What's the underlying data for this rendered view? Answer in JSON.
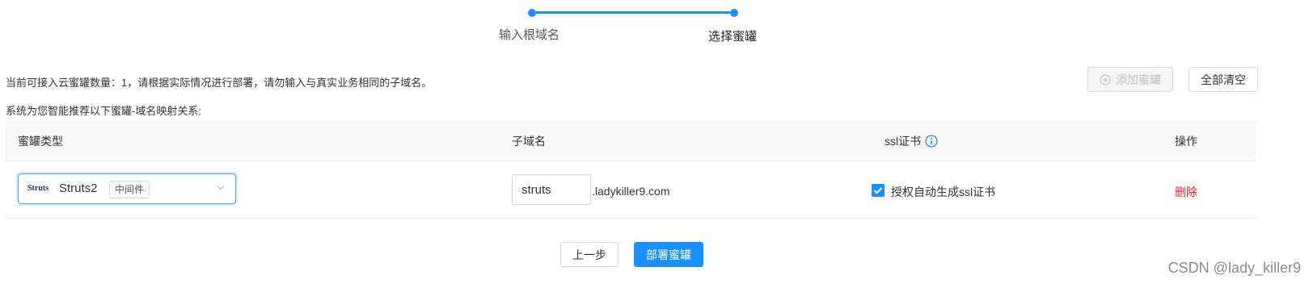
{
  "stepper": {
    "steps": [
      {
        "label": "输入根域名"
      },
      {
        "label": "选择蜜罐"
      }
    ],
    "accent": "#1890ff"
  },
  "notice": {
    "quota_text": "当前可接入云蜜罐数量：1，请根据实际情况进行部署，请勿输入与真实业务相同的子域名。",
    "recommend_text": "系统为您智能推荐以下蜜罐-域名映射关系:"
  },
  "toolbar": {
    "add_label": "添加蜜罐",
    "clear_label": "全部清空"
  },
  "table": {
    "headers": {
      "type": "蜜罐类型",
      "subdomain": "子域名",
      "ssl": "ssl证书",
      "action": "操作"
    },
    "rows": [
      {
        "logo_text": "Struts",
        "type_value": "Struts2",
        "type_tag": "中间件",
        "subdomain_value": "struts",
        "domain_suffix": ".ladykiller9.com",
        "ssl_label": "授权自动生成ssl证书",
        "ssl_checked": true,
        "delete_label": "删除"
      }
    ]
  },
  "footer": {
    "prev_label": "上一步",
    "deploy_label": "部署蜜罐"
  },
  "watermark": "CSDN @lady_killer9",
  "colors": {
    "primary": "#1890ff",
    "danger": "#f5222d",
    "header_bg": "#f8f8f9"
  },
  "icons": [
    "plus-circle-icon",
    "info-circle-icon",
    "chevron-down-icon",
    "check-icon"
  ]
}
